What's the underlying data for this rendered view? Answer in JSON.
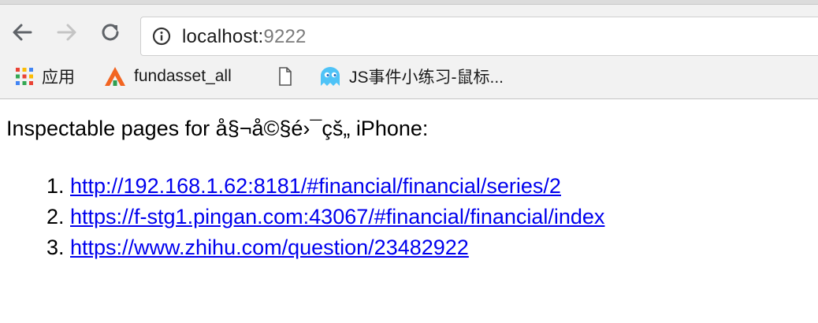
{
  "browser": {
    "url_host": "localhost:",
    "url_port": "9222",
    "bookmarks": [
      {
        "label": "应用",
        "icon": "apps-grid-icon"
      },
      {
        "label": "fundasset_all",
        "icon": "fundasset-logo-icon"
      },
      {
        "label": "",
        "icon": "document-icon"
      },
      {
        "label": "JS事件小练习-鼠标...",
        "icon": "ghost-icon"
      }
    ]
  },
  "page": {
    "heading": "Inspectable pages for å§¬å©§é›¯çš„ iPhone:",
    "links": [
      "http://192.168.1.62:8181/#financial/financial/series/2",
      "https://f-stg1.pingan.com:43067/#financial/financial/index",
      "https://www.zhihu.com/question/23482922"
    ]
  }
}
